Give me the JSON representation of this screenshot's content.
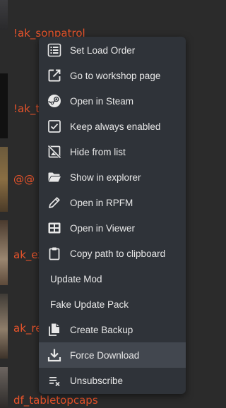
{
  "mod_list": [
    {
      "name": "!ak_sonpatrol"
    },
    {
      "name": "!ak_t"
    },
    {
      "name": "@@"
    },
    {
      "name": "ak_ex"
    },
    {
      "name": "ak_re"
    },
    {
      "name": "df_tabletopcaps"
    }
  ],
  "context_menu": {
    "items": [
      {
        "label": "Set Load Order",
        "icon": "list-order-icon"
      },
      {
        "label": "Go to workshop page",
        "icon": "external-link-icon"
      },
      {
        "label": "Open in Steam",
        "icon": "steam-icon"
      },
      {
        "label": "Keep always enabled",
        "icon": "checkbox-checked-icon"
      },
      {
        "label": "Hide from list",
        "icon": "hide-image-icon"
      },
      {
        "label": "Show in explorer",
        "icon": "folder-open-icon"
      },
      {
        "label": "Open in RPFM",
        "icon": "pencil-icon"
      },
      {
        "label": "Open in Viewer",
        "icon": "table-view-icon"
      },
      {
        "label": "Copy path to clipboard",
        "icon": "clipboard-icon"
      },
      {
        "label": "Update Mod",
        "icon": null
      },
      {
        "label": "Fake Update Pack",
        "icon": null
      },
      {
        "label": "Create Backup",
        "icon": "copy-files-icon"
      },
      {
        "label": "Force Download",
        "icon": "download-icon"
      },
      {
        "label": "Unsubscribe",
        "icon": "clear-list-icon"
      }
    ],
    "hovered_item": "Force Download"
  },
  "colors": {
    "menu_bg": "#2f3339",
    "hover_bg": "#42474f",
    "mod_text": "#e6532b"
  }
}
